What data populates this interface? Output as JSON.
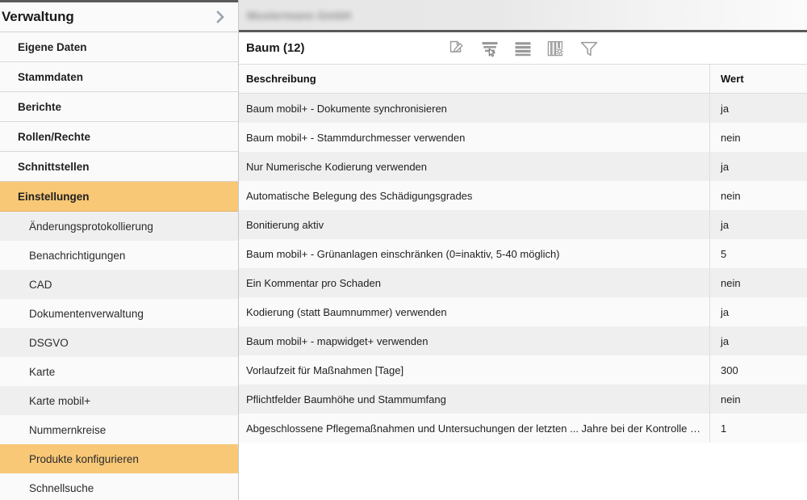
{
  "sidebar": {
    "header": {
      "title": "Verwaltung",
      "expand_icon": "chevron-right-icon"
    },
    "items": [
      {
        "label": "Eigene Daten",
        "level": "top",
        "active": false
      },
      {
        "label": "Stammdaten",
        "level": "top",
        "active": false
      },
      {
        "label": "Berichte",
        "level": "top",
        "active": false
      },
      {
        "label": "Rollen/Rechte",
        "level": "top",
        "active": false
      },
      {
        "label": "Schnittstellen",
        "level": "top",
        "active": false
      },
      {
        "label": "Einstellungen",
        "level": "top",
        "active": true
      },
      {
        "label": "Änderungsprotokollierung",
        "level": "sub",
        "active": false
      },
      {
        "label": "Benachrichtigungen",
        "level": "sub",
        "active": false
      },
      {
        "label": "CAD",
        "level": "sub",
        "active": false
      },
      {
        "label": "Dokumentenverwaltung",
        "level": "sub",
        "active": false
      },
      {
        "label": "DSGVO",
        "level": "sub",
        "active": false
      },
      {
        "label": "Karte",
        "level": "sub",
        "active": false
      },
      {
        "label": "Karte mobil+",
        "level": "sub",
        "active": false
      },
      {
        "label": "Nummernkreise",
        "level": "sub",
        "active": false
      },
      {
        "label": "Produkte konfigurieren",
        "level": "sub",
        "active": true
      },
      {
        "label": "Schnellsuche",
        "level": "sub",
        "active": false
      }
    ]
  },
  "topbar": {
    "redacted_title": "Mustermann GmbH"
  },
  "panel": {
    "title": "Baum (12)",
    "toolbar": [
      {
        "name": "edit-document-icon",
        "tooltip": "Bearbeiten"
      },
      {
        "name": "select-rows-icon",
        "tooltip": "Auswahl"
      },
      {
        "name": "list-rows-icon",
        "tooltip": "Liste"
      },
      {
        "name": "column-settings-icon",
        "tooltip": "Spalten konfigurieren"
      },
      {
        "name": "filter-funnel-icon",
        "tooltip": "Filter"
      }
    ]
  },
  "table": {
    "columns": [
      {
        "key": "description",
        "label": "Beschreibung"
      },
      {
        "key": "value",
        "label": "Wert"
      }
    ],
    "rows": [
      {
        "description": "Baum mobil+ - Dokumente synchronisieren",
        "value": "ja"
      },
      {
        "description": "Baum mobil+ - Stammdurchmesser verwenden",
        "value": "nein"
      },
      {
        "description": "Nur Numerische Kodierung verwenden",
        "value": "ja"
      },
      {
        "description": "Automatische Belegung des Schädigungsgrades",
        "value": "nein"
      },
      {
        "description": "Bonitierung aktiv",
        "value": "ja"
      },
      {
        "description": "Baum mobil+ - Grünanlagen einschränken (0=inaktiv, 5-40 möglich)",
        "value": "5"
      },
      {
        "description": "Ein Kommentar pro Schaden",
        "value": "nein"
      },
      {
        "description": "Kodierung (statt Baumnummer) verwenden",
        "value": "ja"
      },
      {
        "description": "Baum mobil+ - mapwidget+ verwenden",
        "value": "ja"
      },
      {
        "description": "Vorlaufzeit für Maßnahmen [Tage]",
        "value": "300"
      },
      {
        "description": "Pflichtfelder Baumhöhe und Stammumfang",
        "value": "nein"
      },
      {
        "description": "Abgeschlossene Pflegemaßnahmen und Untersuchungen der letzten ... Jahre bei der Kontrolle anzeigen",
        "value": "1"
      }
    ]
  },
  "colors": {
    "accent_orange": "#f8c877",
    "stripe_gray": "#efefef",
    "stripe_light": "#fafafa",
    "rule_dark": "#5a5a5a",
    "icon_gray": "#9a9a9a"
  }
}
